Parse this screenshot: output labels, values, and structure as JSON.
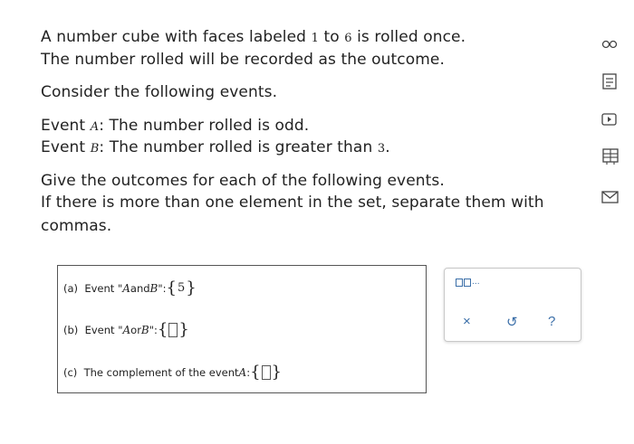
{
  "problem": {
    "line1_a": "A number cube with faces labeled ",
    "line1_n1": "1",
    "line1_b": " to ",
    "line1_n2": "6",
    "line1_c": " is rolled once.",
    "line2": "The number rolled will be recorded as the outcome.",
    "line3": "Consider the following events.",
    "eventA_prefix": "Event ",
    "eventA_var": "A",
    "eventA_text": ": The number rolled is odd.",
    "eventB_prefix": "Event ",
    "eventB_var": "B",
    "eventB_text": ": The number rolled is greater than ",
    "eventB_num": "3",
    "eventB_end": ".",
    "line6": "Give the outcomes for each of the following events.",
    "line7": "If there is more than one element in the set, separate them with",
    "line8": "commas."
  },
  "parts": [
    {
      "label": "(a)",
      "pre": "Event \"",
      "var1": "A",
      "mid": " and ",
      "var2": "B",
      "post": "\": ",
      "value": "5"
    },
    {
      "label": "(b)",
      "pre": "Event \"",
      "var1": "A",
      "mid": " or ",
      "var2": "B",
      "post": "\": ",
      "value": ""
    },
    {
      "label": "(c)",
      "pre": "The complement of the event ",
      "var1": "A",
      "post": ": ",
      "value": ""
    }
  ],
  "toolbar": {
    "set_template_label": "...",
    "clear_symbol": "×",
    "undo_symbol": "↺",
    "help_symbol": "?"
  },
  "colors": {
    "accent": "#3a6ea8",
    "text": "#222222",
    "border": "#555555"
  },
  "sidebar_icons": [
    "infinity-icon",
    "calculator-document-icon",
    "video-play-icon",
    "data-table-icon",
    "mail-icon"
  ]
}
